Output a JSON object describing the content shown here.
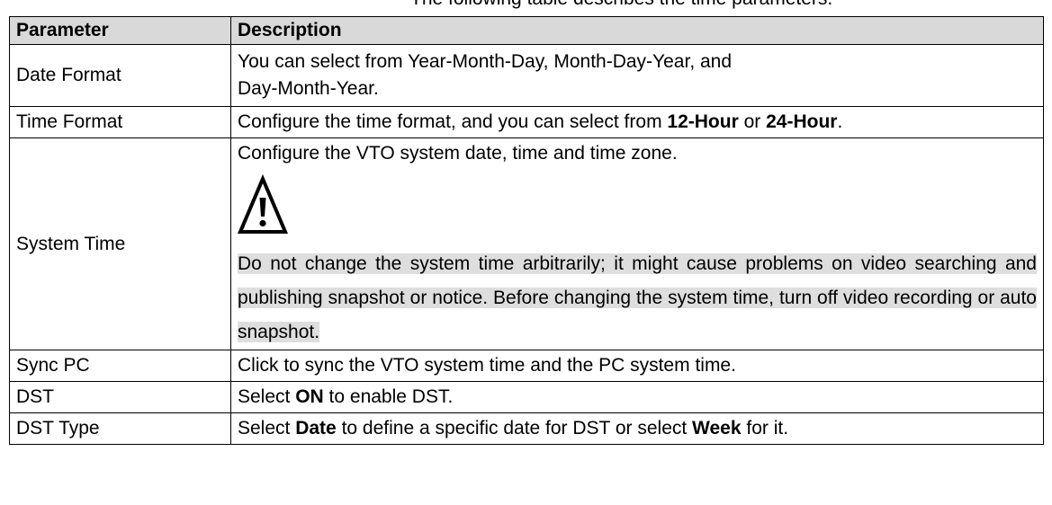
{
  "top_text": "The following table describes the time parameters.",
  "table": {
    "headers": [
      "Parameter",
      "Description"
    ],
    "rows": {
      "date_format": {
        "param": "Date Format",
        "desc": "You can select from Year-Month-Day, Month-Day-Year, and",
        "desc2": "Day-Month-Year."
      },
      "time_format": {
        "param": "Time Format",
        "desc_a": "Configure the time format, and you can select from ",
        "b1": "12-Hour",
        "mid": " or ",
        "b2": "24-Hour",
        "end": "."
      },
      "system_time": {
        "param": "System Time",
        "desc": "Configure the VTO system date, time and time zone.",
        "icon": "warning-icon",
        "note": "Do not change the system time arbitrarily; it might cause problems on video searching and publishing snapshot or notice. Before changing the system time, turn off video recording or auto snapshot."
      },
      "sync_pc": {
        "param": "Sync PC",
        "desc": "Click to sync the VTO system time and the PC system time."
      },
      "dst": {
        "param": "DST",
        "pre": "Select ",
        "b": "ON",
        "post": " to enable DST."
      },
      "dst_type": {
        "param": "DST Type",
        "pre": "Select ",
        "b1": "Date",
        "mid": " to define a specific date for DST or select ",
        "b2": "Week",
        "post": " for it."
      }
    }
  },
  "colors": {
    "header_bg": "#d9d9d9",
    "note_highlight": "#dedede",
    "border": "#000000"
  }
}
